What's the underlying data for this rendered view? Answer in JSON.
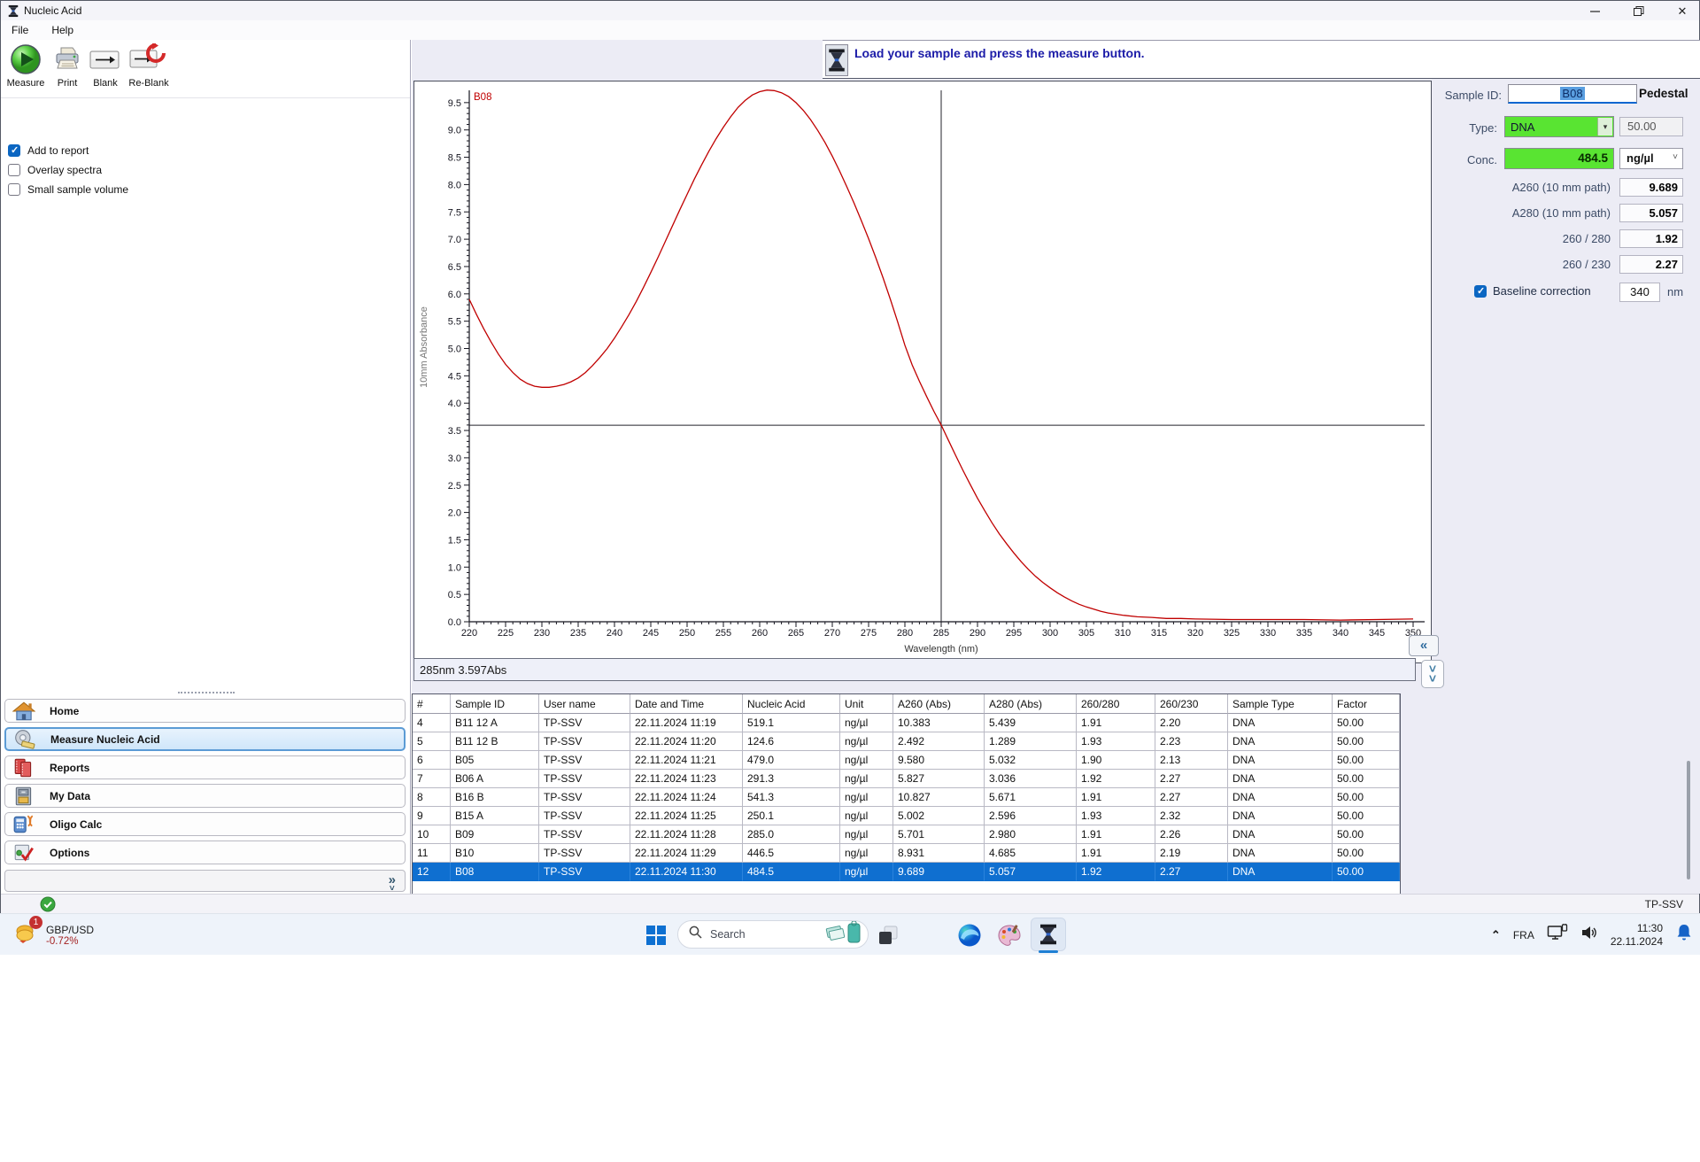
{
  "window": {
    "title": "Nucleic Acid",
    "menu": [
      "File",
      "Help"
    ],
    "status_user": "TP-SSV"
  },
  "toolbar": {
    "buttons": [
      {
        "label": "Measure",
        "icon": "measure-play-icon"
      },
      {
        "label": "Print",
        "icon": "printer-icon"
      },
      {
        "label": "Blank",
        "icon": "blank-arrow-icon"
      },
      {
        "label": "Re-Blank",
        "icon": "reblank-arrow-icon"
      }
    ]
  },
  "report_options": [
    {
      "label": "Add to report",
      "checked": true
    },
    {
      "label": "Overlay spectra",
      "checked": false
    },
    {
      "label": "Small sample volume",
      "checked": false
    }
  ],
  "message": {
    "text": "Load your sample and press the measure button.",
    "icon": "instrument-pedestal-icon"
  },
  "sidebar": {
    "items": [
      {
        "label": "Home",
        "icon": "home-icon",
        "active": false
      },
      {
        "label": "Measure Nucleic Acid",
        "icon": "measure-tape-icon",
        "active": true
      },
      {
        "label": "Reports",
        "icon": "reports-icon",
        "active": false
      },
      {
        "label": "My Data",
        "icon": "my-data-icon",
        "active": false
      },
      {
        "label": "Oligo Calc",
        "icon": "oligo-calc-icon",
        "active": false
      },
      {
        "label": "Options",
        "icon": "options-icon",
        "active": false
      }
    ],
    "collapse_glyph": "»"
  },
  "chart_data": {
    "type": "line",
    "title": "",
    "xlabel": "Wavelength (nm)",
    "ylabel": "10mm Absorbance",
    "xlim": [
      220,
      350
    ],
    "ylim": [
      0,
      9.75
    ],
    "x_tick_step": 5,
    "y_tick_step": 0.5,
    "grid": false,
    "legend_position": "top-left-inside",
    "crosshair": {
      "x": 285,
      "y": 3.597
    },
    "series": [
      {
        "name": "B08",
        "color": "#c00000",
        "points": [
          [
            220,
            5.9
          ],
          [
            221,
            5.62
          ],
          [
            222,
            5.36
          ],
          [
            223,
            5.12
          ],
          [
            224,
            4.9
          ],
          [
            225,
            4.71
          ],
          [
            226,
            4.56
          ],
          [
            227,
            4.44
          ],
          [
            228,
            4.36
          ],
          [
            229,
            4.31
          ],
          [
            230,
            4.29
          ],
          [
            231,
            4.29
          ],
          [
            232,
            4.31
          ],
          [
            233,
            4.34
          ],
          [
            234,
            4.39
          ],
          [
            235,
            4.46
          ],
          [
            236,
            4.56
          ],
          [
            237,
            4.69
          ],
          [
            238,
            4.84
          ],
          [
            239,
            5.0
          ],
          [
            240,
            5.19
          ],
          [
            241,
            5.4
          ],
          [
            242,
            5.62
          ],
          [
            243,
            5.86
          ],
          [
            244,
            6.12
          ],
          [
            245,
            6.39
          ],
          [
            246,
            6.67
          ],
          [
            247,
            6.96
          ],
          [
            248,
            7.25
          ],
          [
            249,
            7.54
          ],
          [
            250,
            7.82
          ],
          [
            251,
            8.1
          ],
          [
            252,
            8.36
          ],
          [
            253,
            8.61
          ],
          [
            254,
            8.84
          ],
          [
            255,
            9.05
          ],
          [
            256,
            9.24
          ],
          [
            257,
            9.41
          ],
          [
            258,
            9.54
          ],
          [
            259,
            9.64
          ],
          [
            260,
            9.7
          ],
          [
            261,
            9.73
          ],
          [
            262,
            9.72
          ],
          [
            263,
            9.68
          ],
          [
            264,
            9.61
          ],
          [
            265,
            9.5
          ],
          [
            266,
            9.36
          ],
          [
            267,
            9.19
          ],
          [
            268,
            8.99
          ],
          [
            269,
            8.77
          ],
          [
            270,
            8.52
          ],
          [
            271,
            8.25
          ],
          [
            272,
            7.96
          ],
          [
            273,
            7.66
          ],
          [
            274,
            7.34
          ],
          [
            275,
            7.01
          ],
          [
            276,
            6.66
          ],
          [
            277,
            6.29
          ],
          [
            278,
            5.9
          ],
          [
            279,
            5.49
          ],
          [
            280,
            5.06
          ],
          [
            281,
            4.7
          ],
          [
            282,
            4.4
          ],
          [
            283,
            4.12
          ],
          [
            284,
            3.85
          ],
          [
            285,
            3.6
          ],
          [
            286,
            3.32
          ],
          [
            287,
            3.04
          ],
          [
            288,
            2.77
          ],
          [
            289,
            2.51
          ],
          [
            290,
            2.26
          ],
          [
            291,
            2.03
          ],
          [
            292,
            1.81
          ],
          [
            293,
            1.61
          ],
          [
            294,
            1.43
          ],
          [
            295,
            1.26
          ],
          [
            296,
            1.1
          ],
          [
            297,
            0.96
          ],
          [
            298,
            0.83
          ],
          [
            299,
            0.72
          ],
          [
            300,
            0.62
          ],
          [
            301,
            0.53
          ],
          [
            302,
            0.45
          ],
          [
            303,
            0.38
          ],
          [
            304,
            0.32
          ],
          [
            305,
            0.27
          ],
          [
            306,
            0.23
          ],
          [
            307,
            0.19
          ],
          [
            308,
            0.16
          ],
          [
            309,
            0.14
          ],
          [
            310,
            0.12
          ],
          [
            312,
            0.09
          ],
          [
            314,
            0.08
          ],
          [
            316,
            0.06
          ],
          [
            318,
            0.06
          ],
          [
            320,
            0.05
          ],
          [
            325,
            0.04
          ],
          [
            330,
            0.04
          ],
          [
            335,
            0.04
          ],
          [
            340,
            0.03
          ],
          [
            345,
            0.04
          ],
          [
            350,
            0.05
          ]
        ]
      }
    ]
  },
  "chart_controls": {
    "collapse_glyph": "«",
    "expand_icon": "double-down-chevron-icon"
  },
  "status_readout": {
    "text": "285nm 3.597Abs"
  },
  "sample_panel": {
    "sample_id_label": "Sample ID:",
    "sample_id": "B08",
    "mode": "Pedestal",
    "type_label": "Type:",
    "type_value": "DNA",
    "factor_value": "50.00",
    "conc_label": "Conc.",
    "conc_value": "484.5",
    "conc_unit": "ng/µl",
    "readings": [
      {
        "label": "A260 (10 mm path)",
        "value": "9.689"
      },
      {
        "label": "A280 (10 mm path)",
        "value": "5.057"
      },
      {
        "label": "260 / 280",
        "value": "1.92"
      },
      {
        "label": "260 / 230",
        "value": "2.27"
      }
    ],
    "baseline": {
      "label": "Baseline correction",
      "checked": true,
      "value": "340",
      "unit": "nm"
    }
  },
  "results_table": {
    "columns": [
      "#",
      "Sample ID",
      "User name",
      "Date and Time",
      "Nucleic Acid",
      "Unit",
      "A260 (Abs)",
      "A280 (Abs)",
      "260/280",
      "260/230",
      "Sample Type",
      "Factor"
    ],
    "rows": [
      [
        "4",
        "B11 12 A",
        "TP-SSV",
        "22.11.2024 11:19",
        "519.1",
        "ng/µl",
        "10.383",
        "5.439",
        "1.91",
        "2.20",
        "DNA",
        "50.00"
      ],
      [
        "5",
        "B11 12 B",
        "TP-SSV",
        "22.11.2024 11:20",
        "124.6",
        "ng/µl",
        "2.492",
        "1.289",
        "1.93",
        "2.23",
        "DNA",
        "50.00"
      ],
      [
        "6",
        "B05",
        "TP-SSV",
        "22.11.2024 11:21",
        "479.0",
        "ng/µl",
        "9.580",
        "5.032",
        "1.90",
        "2.13",
        "DNA",
        "50.00"
      ],
      [
        "7",
        "B06 A",
        "TP-SSV",
        "22.11.2024 11:23",
        "291.3",
        "ng/µl",
        "5.827",
        "3.036",
        "1.92",
        "2.27",
        "DNA",
        "50.00"
      ],
      [
        "8",
        "B16 B",
        "TP-SSV",
        "22.11.2024 11:24",
        "541.3",
        "ng/µl",
        "10.827",
        "5.671",
        "1.91",
        "2.27",
        "DNA",
        "50.00"
      ],
      [
        "9",
        "B15 A",
        "TP-SSV",
        "22.11.2024 11:25",
        "250.1",
        "ng/µl",
        "5.002",
        "2.596",
        "1.93",
        "2.32",
        "DNA",
        "50.00"
      ],
      [
        "10",
        "B09",
        "TP-SSV",
        "22.11.2024 11:28",
        "285.0",
        "ng/µl",
        "5.701",
        "2.980",
        "1.91",
        "2.26",
        "DNA",
        "50.00"
      ],
      [
        "11",
        "B10",
        "TP-SSV",
        "22.11.2024 11:29",
        "446.5",
        "ng/µl",
        "8.931",
        "4.685",
        "1.91",
        "2.19",
        "DNA",
        "50.00"
      ],
      [
        "12",
        "B08",
        "TP-SSV",
        "22.11.2024 11:30",
        "484.5",
        "ng/µl",
        "9.689",
        "5.057",
        "1.92",
        "2.27",
        "DNA",
        "50.00"
      ]
    ],
    "selected_row_index": 8
  },
  "taskbar": {
    "widget": {
      "badge": "1",
      "pair": "GBP/USD",
      "change": "-0.72%"
    },
    "search_placeholder": "Search",
    "tray": {
      "language": "FRA",
      "time": "11:30",
      "date": "22.11.2024"
    }
  },
  "colors": {
    "accent_green": "#59e432",
    "selection_blue": "#0f6fd0",
    "curve_red": "#c00000",
    "message_navy": "#1c1ca8"
  }
}
